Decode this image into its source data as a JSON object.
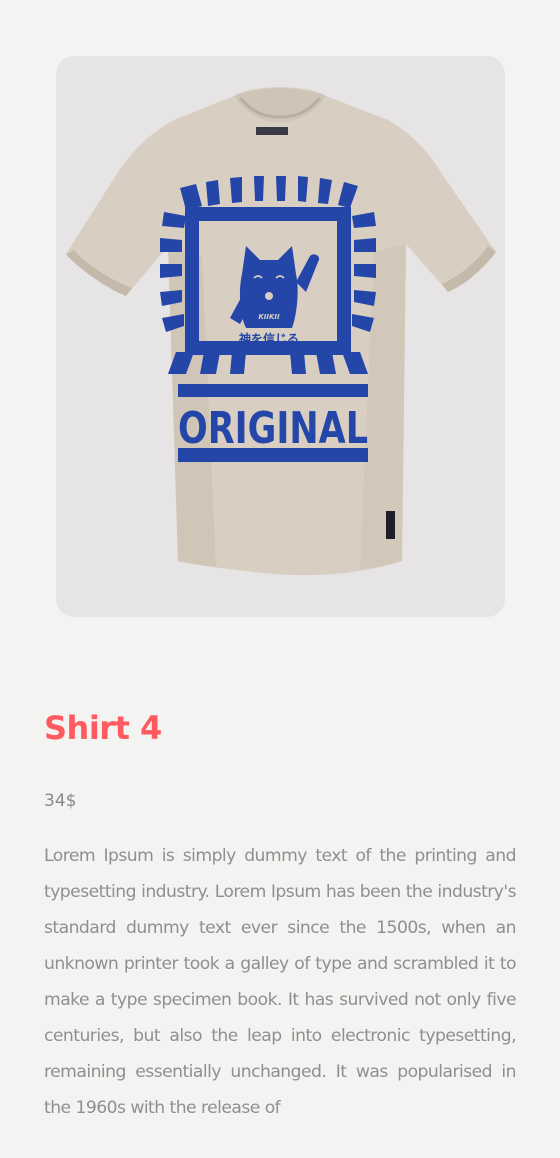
{
  "product": {
    "image_alt": "Shirt 4",
    "print_text": "ORIGINAL",
    "print_japanese": "神を信じる",
    "print_brand": "KIIKII",
    "title": "Shirt 4",
    "price": "34$",
    "description": "Lorem Ipsum is simply dummy text of the printing and typesetting industry. Lorem Ipsum has been the industry's standard dummy text ever since the 1500s, when an unknown printer took a galley of type and scrambled it to make a type specimen book. It has survived not only five centuries, but also the leap into electronic typesetting, remaining essentially unchanged. It was popularised in the 1960s with the release of"
  },
  "colors": {
    "page_background": "#f3f4f1",
    "image_background": "#e6e4e5",
    "title": "#ff5a5f",
    "text": "#8f8f8f",
    "shirt": "#d8cfc2",
    "print": "#2346a8"
  }
}
